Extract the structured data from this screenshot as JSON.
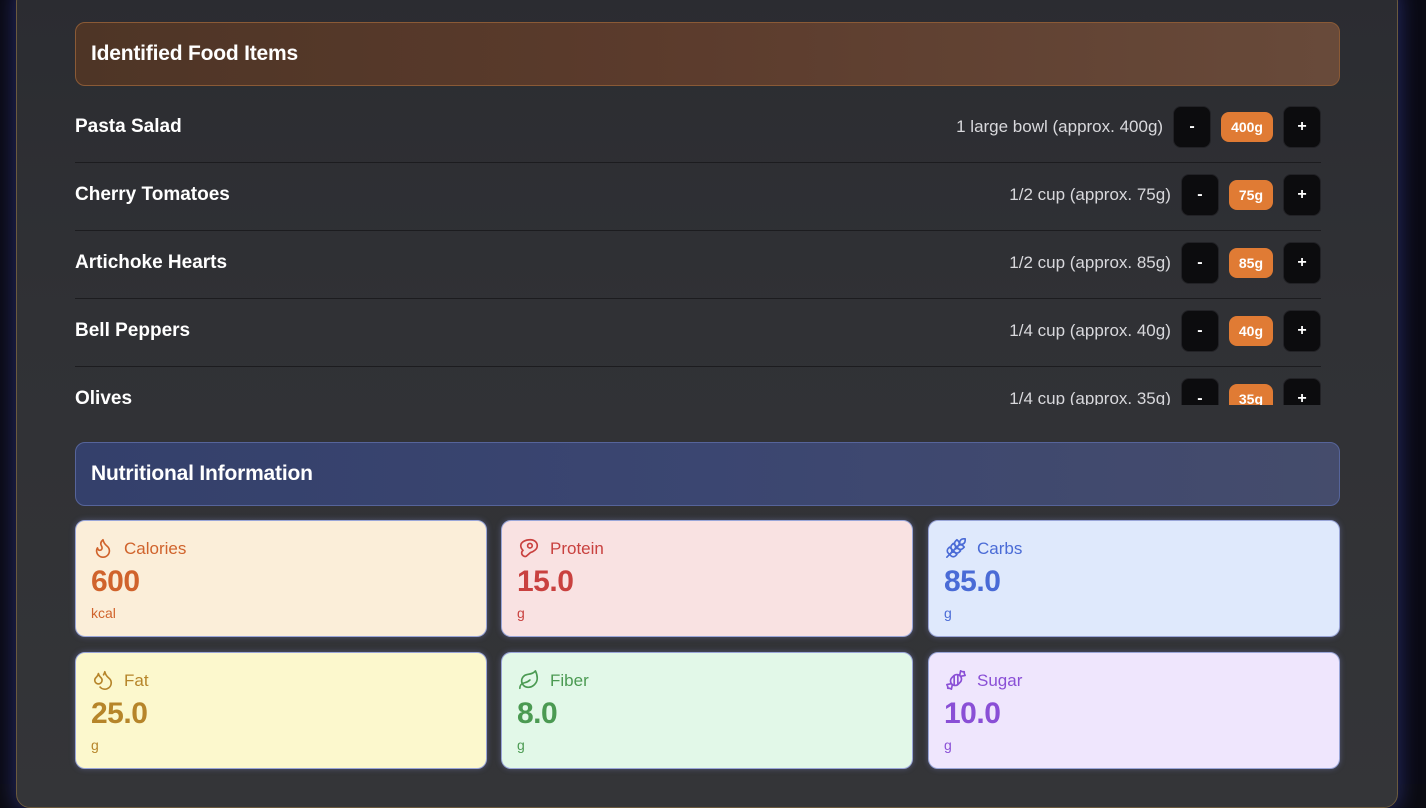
{
  "food_section": {
    "title": "Identified Food Items",
    "items": [
      {
        "name": "Pasta Salad",
        "portion": "1 large bowl (approx. 400g)",
        "grams": "400g",
        "minus": "-",
        "plus": "+"
      },
      {
        "name": "Cherry Tomatoes",
        "portion": "1/2 cup (approx. 75g)",
        "grams": "75g",
        "minus": "-",
        "plus": "+"
      },
      {
        "name": "Artichoke Hearts",
        "portion": "1/2 cup (approx. 85g)",
        "grams": "85g",
        "minus": "-",
        "plus": "+"
      },
      {
        "name": "Bell Peppers",
        "portion": "1/4 cup (approx. 40g)",
        "grams": "40g",
        "minus": "-",
        "plus": "+"
      },
      {
        "name": "Olives",
        "portion": "1/4 cup (approx. 35g)",
        "grams": "35g",
        "minus": "-",
        "plus": "+"
      }
    ]
  },
  "nutrition_section": {
    "title": "Nutritional Information",
    "cards": [
      {
        "label": "Calories",
        "value": "600",
        "unit": "kcal",
        "icon": "flame-icon",
        "bg": "#fbeed9",
        "color": "#d0632c"
      },
      {
        "label": "Protein",
        "value": "15.0",
        "unit": "g",
        "icon": "meat-icon",
        "bg": "#f9e2e2",
        "color": "#c9413f"
      },
      {
        "label": "Carbs",
        "value": "85.0",
        "unit": "g",
        "icon": "wheat-icon",
        "bg": "#dfe9fc",
        "color": "#4a6bd6"
      },
      {
        "label": "Fat",
        "value": "25.0",
        "unit": "g",
        "icon": "droplets-icon",
        "bg": "#fcf8cd",
        "color": "#b6852a"
      },
      {
        "label": "Fiber",
        "value": "8.0",
        "unit": "g",
        "icon": "leaf-icon",
        "bg": "#e2f8e8",
        "color": "#4b9a52"
      },
      {
        "label": "Sugar",
        "value": "10.0",
        "unit": "g",
        "icon": "candy-icon",
        "bg": "#efe6fd",
        "color": "#8a4fd6"
      }
    ]
  }
}
